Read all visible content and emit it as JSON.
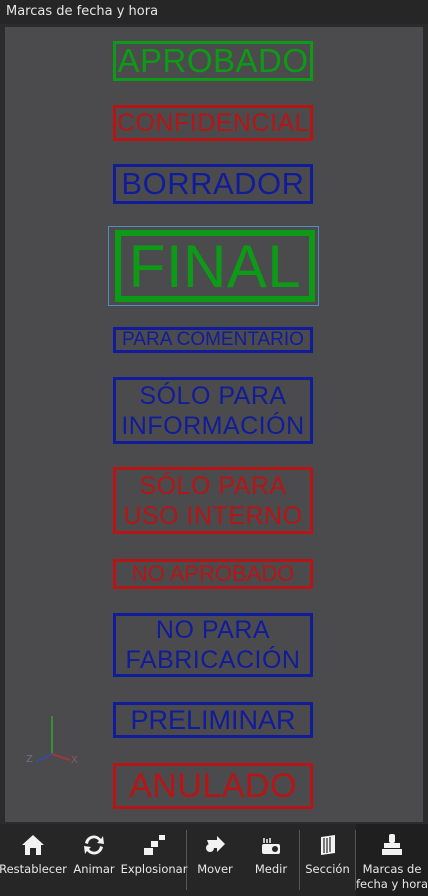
{
  "window": {
    "title": "Marcas de fecha y hora"
  },
  "stamps": [
    {
      "id": "aprobado",
      "lines": [
        "APROBADO"
      ],
      "color": "green"
    },
    {
      "id": "confidencial",
      "lines": [
        "CONFIDENCIAL"
      ],
      "color": "red"
    },
    {
      "id": "borrador",
      "lines": [
        "BORRADOR"
      ],
      "color": "blue"
    },
    {
      "id": "final",
      "lines": [
        "FINAL"
      ],
      "color": "green"
    },
    {
      "id": "para-comentario",
      "lines": [
        "PARA COMENTARIO"
      ],
      "color": "blue"
    },
    {
      "id": "solo-informacion",
      "lines": [
        "SÓLO PARA",
        "INFORMACIÓN"
      ],
      "color": "blue"
    },
    {
      "id": "solo-uso-interno",
      "lines": [
        "SÓLO PARA",
        "USO INTERNO"
      ],
      "color": "red"
    },
    {
      "id": "no-aprobado",
      "lines": [
        "NO APROBADO"
      ],
      "color": "red"
    },
    {
      "id": "no-fabricacion",
      "lines": [
        "NO PARA",
        "FABRICACIÓN"
      ],
      "color": "blue"
    },
    {
      "id": "preliminar",
      "lines": [
        "PRELIMINAR"
      ],
      "color": "blue"
    },
    {
      "id": "anulado",
      "lines": [
        "ANULADO"
      ],
      "color": "red"
    }
  ],
  "axis": {
    "z": "Z",
    "x": "X"
  },
  "toolbar": {
    "items": [
      {
        "id": "restablecer",
        "label": "Restablecer",
        "icon": "home-icon"
      },
      {
        "id": "animar",
        "label": "Animar",
        "icon": "animate-icon"
      },
      {
        "id": "explosionar",
        "label": "Explosionar",
        "icon": "explode-icon"
      },
      {
        "id": "mover",
        "label": "Mover",
        "icon": "move-icon"
      },
      {
        "id": "medir",
        "label": "Medir",
        "icon": "measure-icon"
      },
      {
        "id": "seccion",
        "label": "Sección",
        "icon": "section-icon"
      },
      {
        "id": "marcas",
        "label": "Marcas de fecha y hora",
        "label_lines": [
          "Marcas de",
          "fecha y hora"
        ],
        "icon": "stamp-icon",
        "active": true
      }
    ]
  }
}
